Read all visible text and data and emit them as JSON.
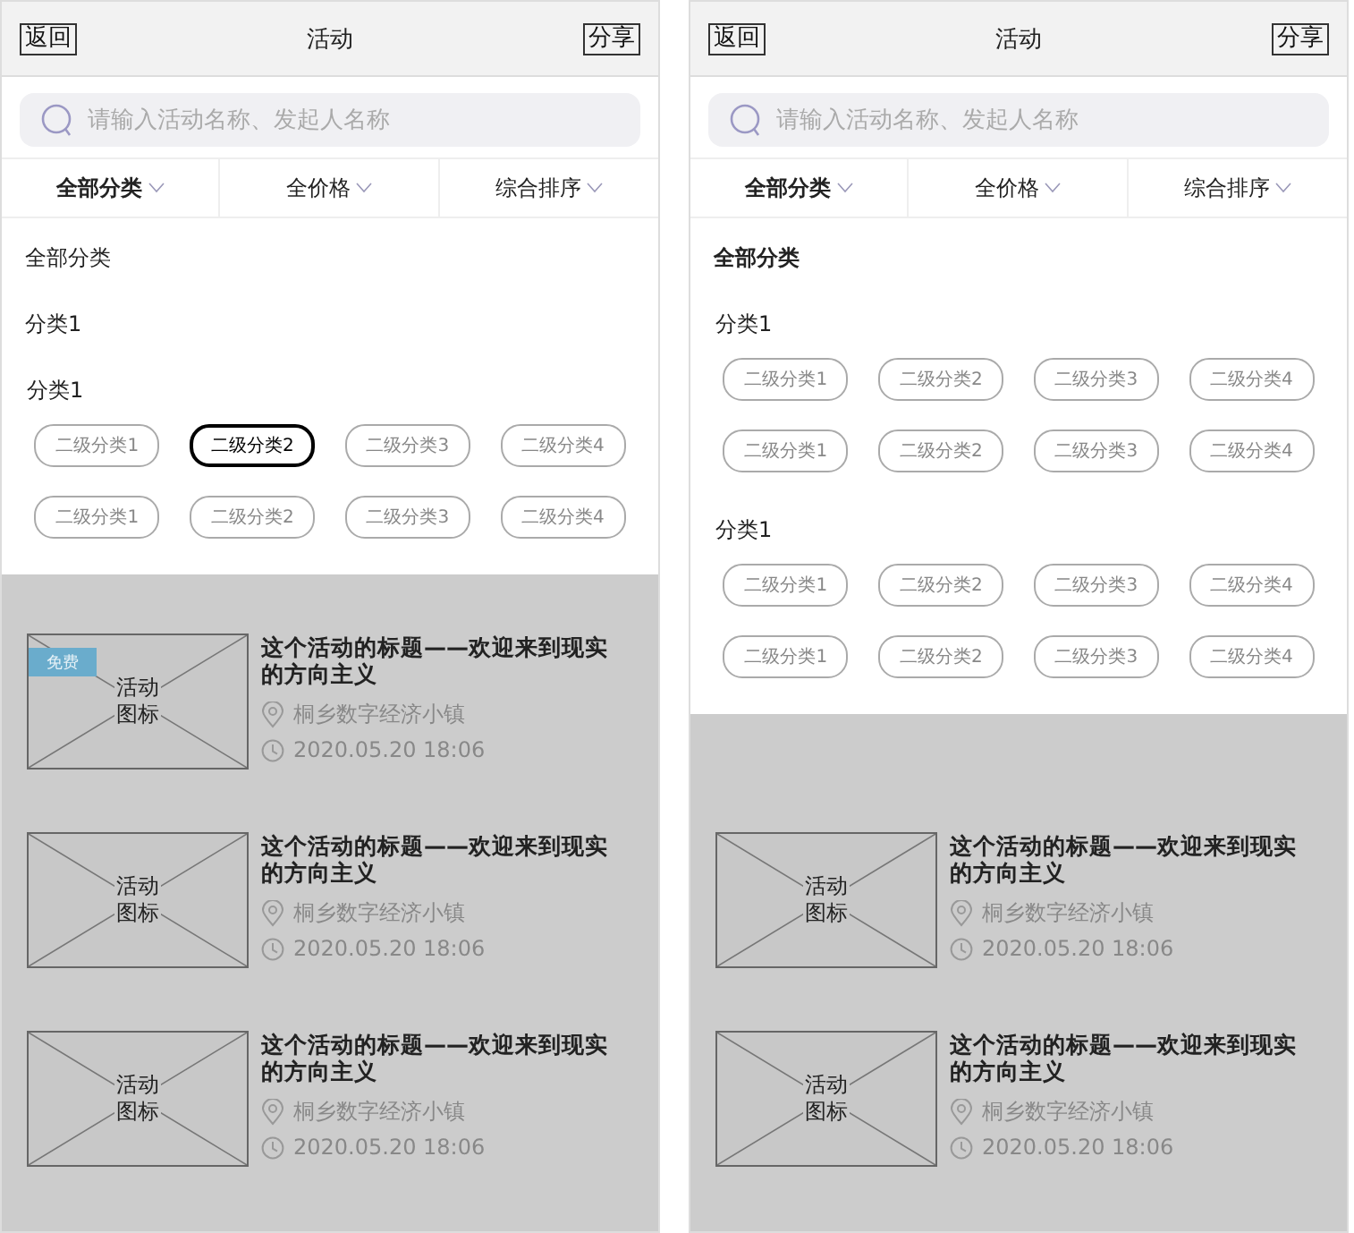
{
  "screens": [
    {
      "header": {
        "back": "返回",
        "title": "活动",
        "share": "分享"
      },
      "search": {
        "placeholder": "请输入活动名称、发起人名称"
      },
      "filters": [
        {
          "label": "全部分类",
          "selected": true
        },
        {
          "label": "全价格",
          "selected": false
        },
        {
          "label": "综合排序",
          "selected": false
        }
      ],
      "dropdown": [
        {
          "kind": "option",
          "label": "全部分类",
          "selected": false
        },
        {
          "kind": "option",
          "label": "分类1",
          "selected": false
        },
        {
          "kind": "group",
          "label": "分类1",
          "chips": [
            {
              "label": "二级分类1",
              "selected": false
            },
            {
              "label": "二级分类2",
              "selected": true
            },
            {
              "label": "二级分类3",
              "selected": false
            },
            {
              "label": "二级分类4",
              "selected": false
            },
            {
              "label": "二级分类1",
              "selected": false
            },
            {
              "label": "二级分类2",
              "selected": false
            },
            {
              "label": "二级分类3",
              "selected": false
            },
            {
              "label": "二级分类4",
              "selected": false
            }
          ]
        }
      ],
      "activities": [
        {
          "badge": "免费",
          "image_label": "活动图标",
          "title": "这个活动的标题——欢迎来到现实的方向主义",
          "location": "桐乡数字经济小镇",
          "time": "2020.05.20 18:06"
        },
        {
          "image_label": "活动图标",
          "title": "这个活动的标题——欢迎来到现实的方向主义",
          "location": "桐乡数字经济小镇",
          "time": "2020.05.20 18:06"
        },
        {
          "image_label": "活动图标",
          "title": "这个活动的标题——欢迎来到现实的方向主义",
          "location": "桐乡数字经济小镇",
          "time": "2020.05.20 18:06"
        }
      ]
    },
    {
      "header": {
        "back": "返回",
        "title": "活动",
        "share": "分享"
      },
      "search": {
        "placeholder": "请输入活动名称、发起人名称"
      },
      "filters": [
        {
          "label": "全部分类",
          "selected": true
        },
        {
          "label": "全价格",
          "selected": false
        },
        {
          "label": "综合排序",
          "selected": false
        }
      ],
      "dropdown": [
        {
          "kind": "option",
          "label": "全部分类",
          "selected": true
        },
        {
          "kind": "group",
          "label": "分类1",
          "chips": [
            {
              "label": "二级分类1",
              "selected": false
            },
            {
              "label": "二级分类2",
              "selected": false
            },
            {
              "label": "二级分类3",
              "selected": false
            },
            {
              "label": "二级分类4",
              "selected": false
            },
            {
              "label": "二级分类1",
              "selected": false
            },
            {
              "label": "二级分类2",
              "selected": false
            },
            {
              "label": "二级分类3",
              "selected": false
            },
            {
              "label": "二级分类4",
              "selected": false
            }
          ]
        },
        {
          "kind": "group",
          "label": "分类1",
          "chips": [
            {
              "label": "二级分类1",
              "selected": false
            },
            {
              "label": "二级分类2",
              "selected": false
            },
            {
              "label": "二级分类3",
              "selected": false
            },
            {
              "label": "二级分类4",
              "selected": false
            },
            {
              "label": "二级分类1",
              "selected": false
            },
            {
              "label": "二级分类2",
              "selected": false
            },
            {
              "label": "二级分类3",
              "selected": false
            },
            {
              "label": "二级分类4",
              "selected": false
            }
          ]
        }
      ],
      "activities": [
        {
          "image_label": "活动图标",
          "title": "这个活动的标题——欢迎来到现实的方向主义",
          "location": "桐乡数字经济小镇",
          "time": "2020.05.20 18:06"
        },
        {
          "image_label": "活动图标",
          "title": "这个活动的标题——欢迎来到现实的方向主义",
          "location": "桐乡数字经济小镇",
          "time": "2020.05.20 18:06"
        }
      ]
    }
  ]
}
